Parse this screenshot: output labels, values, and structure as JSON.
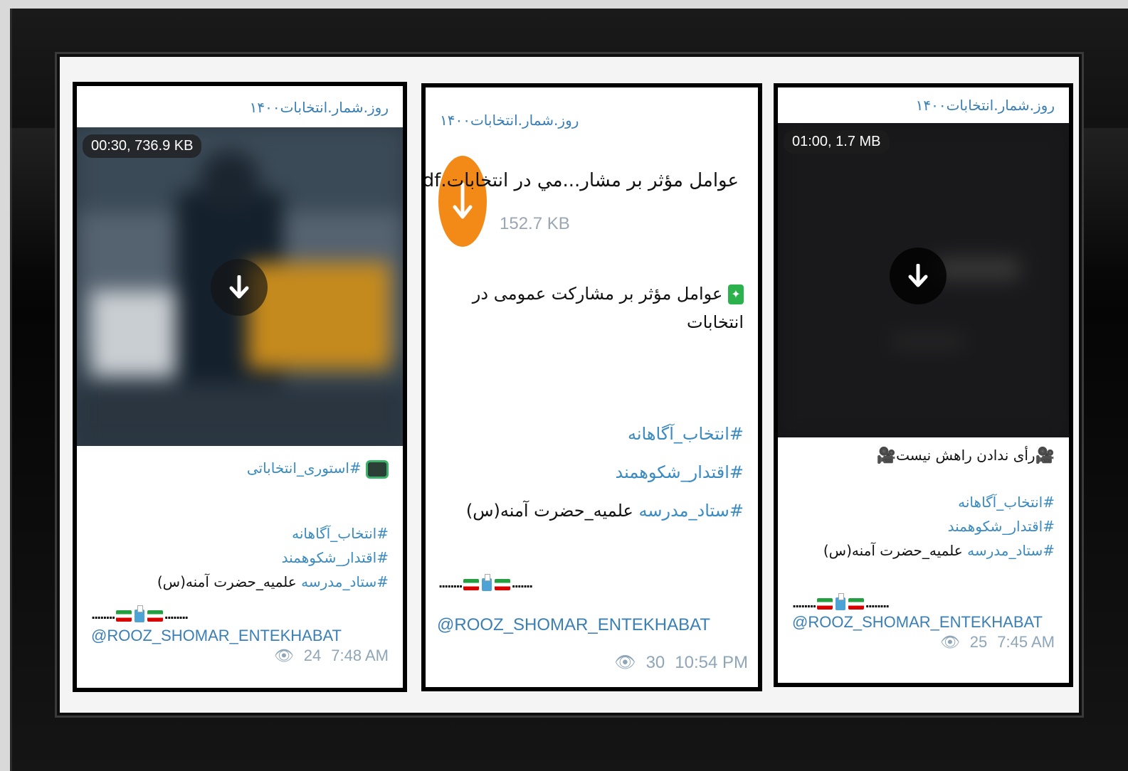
{
  "card_left": {
    "channel": "روز.شمار.انتخابات۱۴۰۰",
    "video_meta": "00:30, 736.9 KB",
    "caption_title": "#استوری_انتخاباتی",
    "tags": [
      "#انتخاب_آگاهانه",
      "#اقتدار_شکوهمند"
    ],
    "tag_staff": "#ستاد_مدرسه",
    "staff_rest": "علمیه_حضرت آمنه(س)",
    "signature": "@ROOZ_SHOMAR_ENTEKHABAT",
    "views": "24",
    "time": "7:48 AM"
  },
  "card_middle": {
    "channel": "روز.شمار.انتخابات۱۴۰۰",
    "file_name": "عوامل مؤثر بر مشار...مي در انتخابات.pdf",
    "file_size": "152.7 KB",
    "headline": "عوامل مؤثر بر مشارکت عمومی در انتخابات",
    "tags": [
      "#انتخاب_آگاهانه",
      "#اقتدار_شکوهمند"
    ],
    "tag_staff": "#ستاد_مدرسه",
    "staff_rest": "علمیه_حضرت آمنه(س)",
    "signature": "@ROOZ_SHOMAR_ENTEKHABAT",
    "views": "30",
    "time": "10:54 PM"
  },
  "card_right": {
    "channel": "روز.شمار.انتخابات۱۴۰۰",
    "video_meta": "01:00, 1.7 MB",
    "caption_title": "رأی ندادن راهش نیست",
    "tags": [
      "#انتخاب_آگاهانه",
      "#اقتدار_شکوهمند"
    ],
    "tag_staff": "#ستاد_مدرسه",
    "staff_rest": "علمیه_حضرت آمنه(س)",
    "signature": "@ROOZ_SHOMAR_ENTEKHABAT",
    "views": "25",
    "time": "7:45 AM"
  },
  "colors": {
    "link": "#3a8bc2",
    "file_icon": "#f38a18",
    "meta": "#8ea6b8"
  },
  "icons": [
    "download-icon",
    "eye-icon",
    "film-camera-icon",
    "iran-flag-icon",
    "ballot-box-icon",
    "tv-icon",
    "sparkle-badge-icon"
  ]
}
